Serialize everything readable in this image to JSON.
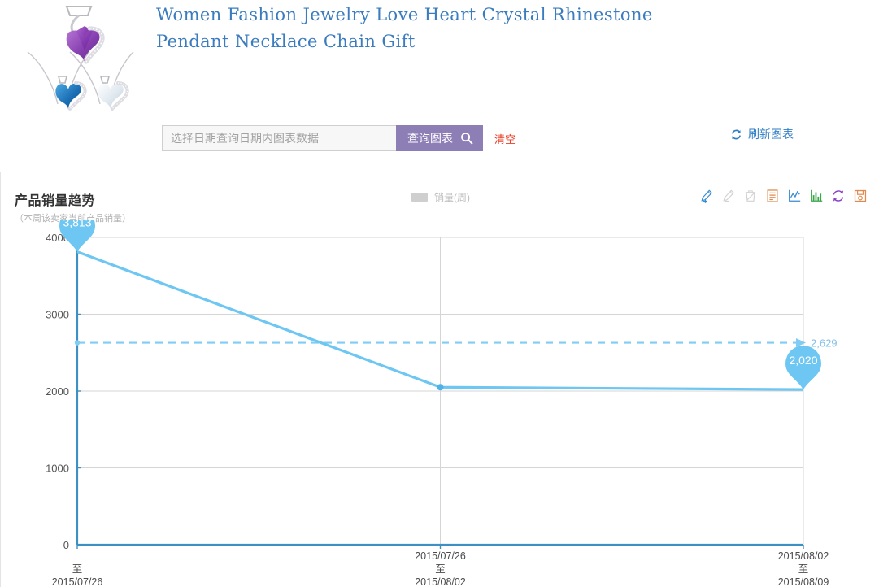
{
  "product": {
    "title": "Women Fashion Jewelry Love Heart Crystal Rhinestone Pendant Necklace Chain Gift",
    "image_alt": "heart-pendant-necklaces"
  },
  "query_bar": {
    "date_placeholder": "选择日期查询日期内图表数据",
    "date_value": "",
    "query_button_label": "查询图表",
    "clear_label": "清空",
    "refresh_label": "刷新图表"
  },
  "chart_panel": {
    "title": "产品销量趋势",
    "subtitle": "（本周该卖家当前产品销量）",
    "legend_label": "销量(周)",
    "legend_color": "#cfcfcf",
    "toolbar": [
      {
        "name": "pencil-add-icon",
        "title": "添加"
      },
      {
        "name": "pencil-remove-icon",
        "title": "移除"
      },
      {
        "name": "trash-icon",
        "title": "删除"
      },
      {
        "name": "document-icon",
        "title": "数据表"
      },
      {
        "name": "line-chart-icon",
        "title": "折线图"
      },
      {
        "name": "bar-chart-icon",
        "title": "柱状图"
      },
      {
        "name": "refresh-icon",
        "title": "刷新"
      },
      {
        "name": "save-icon",
        "title": "保存"
      }
    ]
  },
  "chart_data": {
    "type": "line",
    "title": "产品销量趋势",
    "subtitle": "（本周该卖家当前产品销量）",
    "xlabel": "",
    "ylabel": "",
    "categories": [
      "\n至\n2015/07/26",
      "2015/07/26\n至\n2015/08/02",
      "2015/08/02\n至\n2015/08/09"
    ],
    "category_lines": [
      [
        "",
        "至",
        "2015/07/26"
      ],
      [
        "2015/07/26",
        "至",
        "2015/08/02"
      ],
      [
        "2015/08/02",
        "至",
        "2015/08/09"
      ]
    ],
    "series": [
      {
        "name": "销量(周)",
        "color": "#6ec7f2",
        "values": [
          3813,
          2050,
          2020
        ]
      }
    ],
    "point_labels": [
      "3,813",
      "",
      "2,020"
    ],
    "average_line": {
      "value": 2629,
      "label": "2,629",
      "style": "dashed",
      "color": "#7fcdf5"
    },
    "yticks": [
      0,
      1000,
      2000,
      3000,
      4000
    ],
    "ytick_labels": [
      "0",
      "1000",
      "2000",
      "3000",
      "4000"
    ],
    "ylim": [
      0,
      4390
    ],
    "grid": true,
    "legend_position": "top-center",
    "axis_color": "#3d8fc4",
    "grid_color": "#d5d5d5"
  }
}
